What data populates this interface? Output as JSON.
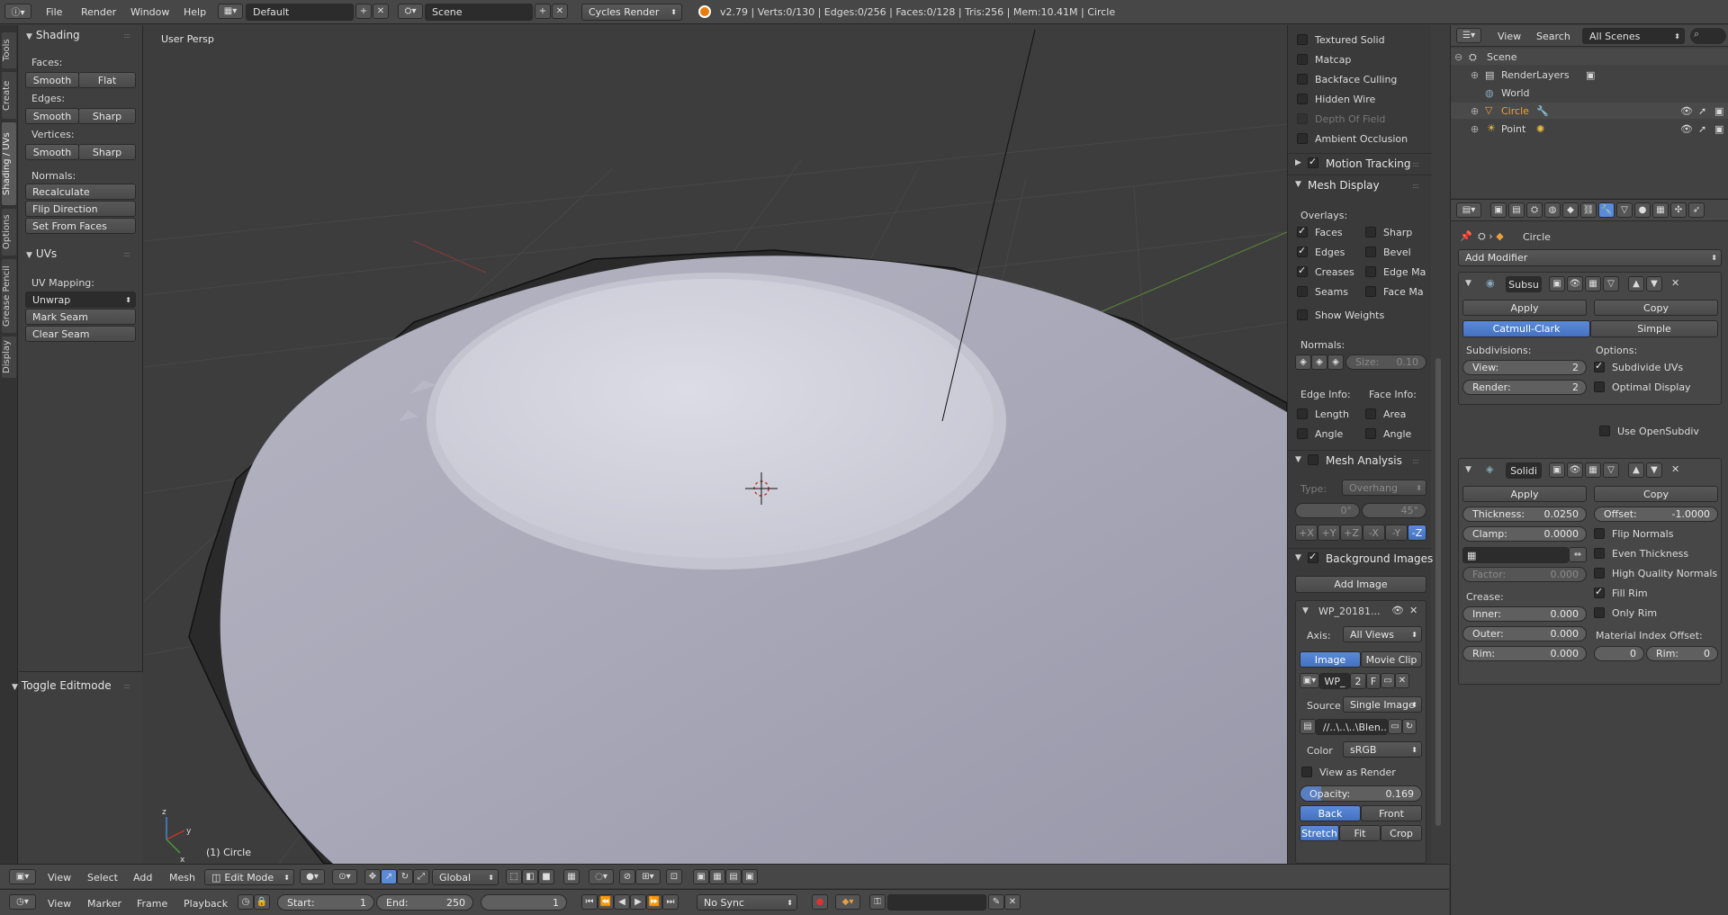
{
  "topbar": {
    "menu_file": "File",
    "menu_render": "Render",
    "menu_window": "Window",
    "menu_help": "Help",
    "layout": "Default",
    "scene": "Scene",
    "engine": "Cycles Render",
    "stats": "v2.79 | Verts:0/130 | Edges:0/256 | Faces:0/128 | Tris:256 | Mem:10.41M | Circle"
  },
  "tooltabs": [
    "Tools",
    "Create",
    "Shading / UVs",
    "Options",
    "Grease Pencil",
    "Display"
  ],
  "shading": {
    "title": "Shading",
    "faces": "Faces:",
    "edges": "Edges:",
    "vertices": "Vertices:",
    "normals": "Normals:",
    "smooth": "Smooth",
    "flat": "Flat",
    "sharp": "Sharp",
    "recalculate": "Recalculate",
    "flip": "Flip Direction",
    "set_from_faces": "Set From Faces"
  },
  "uvs": {
    "title": "UVs",
    "mapping": "UV Mapping:",
    "unwrap": "Unwrap",
    "mark_seam": "Mark Seam",
    "clear_seam": "Clear Seam"
  },
  "toggle_editmode": "Toggle Editmode",
  "viewport": {
    "label": "User Persp",
    "object": "(1) Circle"
  },
  "props": {
    "textured_solid": "Textured Solid",
    "matcap": "Matcap",
    "backface_culling": "Backface Culling",
    "hidden_wire": "Hidden Wire",
    "depth_of_field": "Depth Of Field",
    "ambient_occlusion": "Ambient Occlusion",
    "motion_tracking": "Motion Tracking",
    "mesh_display": "Mesh Display",
    "overlays": "Overlays:",
    "faces": "Faces",
    "sharp": "Sharp",
    "edges": "Edges",
    "bevel": "Bevel",
    "creases": "Creases",
    "edge_ma": "Edge Ma",
    "seams": "Seams",
    "face_ma": "Face Ma",
    "show_weights": "Show Weights",
    "normals": "Normals:",
    "size": "Size:",
    "size_val": "0.10",
    "edge_info": "Edge Info:",
    "face_info": "Face Info:",
    "length": "Length",
    "area": "Area",
    "angle": "Angle",
    "angle2": "Angle",
    "mesh_analysis": "Mesh Analysis",
    "type": "Type:",
    "overhang": "Overhang",
    "deg0": "0°",
    "deg45": "45°",
    "axes": [
      "+X",
      "+Y",
      "+Z",
      "-X",
      "-Y",
      "-Z"
    ],
    "bg_images": "Background Images",
    "add_image": "Add Image",
    "wp_name": "WP_20181...",
    "axis": "Axis:",
    "all_views": "All Views",
    "image": "Image",
    "movie_clip": "Movie Clip",
    "wp_short": "WP_",
    "num2": "2",
    "f": "F",
    "source": "Source",
    "single_image": "Single Image",
    "path": "//..\\..\\..\\Blen...",
    "color": "Color",
    "srgb": "sRGB",
    "view_as_render": "View as Render",
    "opacity": "Opacity:",
    "opacity_val": "0.169",
    "back": "Back",
    "front": "Front",
    "stretch": "Stretch",
    "fit": "Fit",
    "crop": "Crop"
  },
  "outliner": {
    "view": "View",
    "search": "Search",
    "all_scenes": "All Scenes",
    "scene": "Scene",
    "render_layers": "RenderLayers",
    "world": "World",
    "circle": "Circle",
    "point": "Point"
  },
  "modifiers": {
    "object": "Circle",
    "add_modifier": "Add Modifier",
    "subsurf_name": "Subsu",
    "apply": "Apply",
    "copy": "Copy",
    "catmull": "Catmull-Clark",
    "simple": "Simple",
    "subdivisions": "Subdivisions:",
    "options": "Options:",
    "view": "View:",
    "view_val": "2",
    "render": "Render:",
    "render_val": "2",
    "subdivide_uvs": "Subdivide UVs",
    "optimal_display": "Optimal Display",
    "use_opensubdiv": "Use OpenSubdiv",
    "solid_name": "Solidi",
    "thickness": "Thickness:",
    "thickness_val": "0.0250",
    "offset": "Offset:",
    "offset_val": "-1.0000",
    "clamp": "Clamp:",
    "clamp_val": "0.0000",
    "flip_normals": "Flip Normals",
    "even_thickness": "Even Thickness",
    "hq_normals": "High Quality Normals",
    "factor": "Factor:",
    "factor_val": "0.000",
    "fill_rim": "Fill Rim",
    "only_rim": "Only Rim",
    "crease": "Crease:",
    "inner": "Inner:",
    "inner_val": "0.000",
    "outer": "Outer:",
    "outer_val": "0.000",
    "rim": "Rim:",
    "rim_val": "0.000",
    "mat_index": "Material Index Offset:",
    "mat_val": "0",
    "rim2": "Rim:",
    "rim2_val": "0"
  },
  "view3d_header": {
    "view": "View",
    "select": "Select",
    "add": "Add",
    "mesh": "Mesh",
    "mode": "Edit Mode",
    "orient": "Global"
  },
  "timeline": {
    "view": "View",
    "marker": "Marker",
    "frame": "Frame",
    "playback": "Playback",
    "start": "Start:",
    "start_val": "1",
    "end": "End:",
    "end_val": "250",
    "current": "1",
    "sync": "No Sync"
  }
}
